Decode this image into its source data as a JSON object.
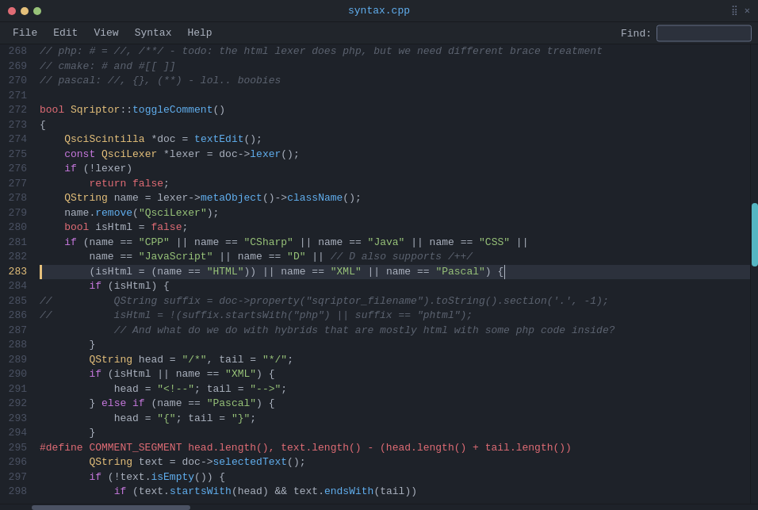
{
  "titlebar": {
    "filename": "syntax.cpp",
    "dots": [
      "close",
      "min",
      "max"
    ],
    "window_btns": [
      "⣿",
      "✕"
    ]
  },
  "menubar": {
    "items": [
      "File",
      "Edit",
      "View",
      "Syntax",
      "Help"
    ]
  },
  "findbar": {
    "label": "Find:",
    "placeholder": ""
  },
  "editor": {
    "lines": [
      {
        "num": 268,
        "content": "cmt",
        "text": "// php: # = //, /**/ - todo: the html lexer does php, but we need different brace treatment"
      },
      {
        "num": 269,
        "content": "cmt",
        "text": "// cmake: # and #[[ ]]"
      },
      {
        "num": 270,
        "content": "cmt",
        "text": "// pascal: //, {}, (**) - lol.. boobies"
      },
      {
        "num": 271,
        "content": "empty",
        "text": ""
      },
      {
        "num": 272,
        "content": "func_decl",
        "text": "bool Sqriptor::toggleComment()"
      },
      {
        "num": 273,
        "content": "brace",
        "text": "{"
      },
      {
        "num": 274,
        "content": "code",
        "text": "    QsciScintilla *doc = textEdit();"
      },
      {
        "num": 275,
        "content": "code",
        "text": "    const QsciLexer *lexer = doc->lexer();"
      },
      {
        "num": 276,
        "content": "code",
        "text": "    if (!lexer)"
      },
      {
        "num": 277,
        "content": "code",
        "text": "        return false;"
      },
      {
        "num": 278,
        "content": "code",
        "text": "    QString name = lexer->metaObject()->className();"
      },
      {
        "num": 279,
        "content": "code",
        "text": "    name.remove(\"QsciLexer\");"
      },
      {
        "num": 280,
        "content": "code",
        "text": "    bool isHtml = false;"
      },
      {
        "num": 281,
        "content": "code",
        "text": "    if (name == \"CPP\" || name == \"CSharp\" || name == \"Java\" || name == \"CSS\" ||"
      },
      {
        "num": 282,
        "content": "code",
        "text": "        name == \"JavaScript\" || name == \"D\" || // D also supports /++/"
      },
      {
        "num": 283,
        "content": "code_hl",
        "text": "        (isHtml = (name == \"HTML\")) || name == \"XML\" || name == \"Pascal\") {"
      },
      {
        "num": 284,
        "content": "code",
        "text": "        if (isHtml) {"
      },
      {
        "num": 285,
        "content": "cmt_code",
        "text": "//          QString suffix = doc->property(\"sqriptor_filename\").toString().section('.', -1);"
      },
      {
        "num": 286,
        "content": "cmt_code",
        "text": "//          isHtml = !(suffix.startsWith(\"php\") || suffix == \"phtml\");"
      },
      {
        "num": 287,
        "content": "code",
        "text": "            // And what do we do with hybrids that are mostly html with some php code inside?"
      },
      {
        "num": 288,
        "content": "code",
        "text": "        }"
      },
      {
        "num": 289,
        "content": "code",
        "text": "        QString head = \"/*\", tail = \"*/\";"
      },
      {
        "num": 290,
        "content": "code",
        "text": "        if (isHtml || name == \"XML\") {"
      },
      {
        "num": 291,
        "content": "code",
        "text": "            head = \"<!--\"; tail = \"-->\";"
      },
      {
        "num": 292,
        "content": "code",
        "text": "        } else if (name == \"Pascal\") {"
      },
      {
        "num": 293,
        "content": "code",
        "text": "            head = \"{\"; tail = \"}\";"
      },
      {
        "num": 294,
        "content": "code",
        "text": "        }"
      },
      {
        "num": 295,
        "content": "macro",
        "text": "#define COMMENT_SEGMENT head.length(), text.length() - (head.length() + tail.length())"
      },
      {
        "num": 296,
        "content": "code",
        "text": "        QString text = doc->selectedText();"
      },
      {
        "num": 297,
        "content": "code",
        "text": "        if (!text.isEmpty()) {"
      },
      {
        "num": 298,
        "content": "code",
        "text": "            if (text.startsWith(head) && text.endsWith(tail))"
      }
    ]
  }
}
